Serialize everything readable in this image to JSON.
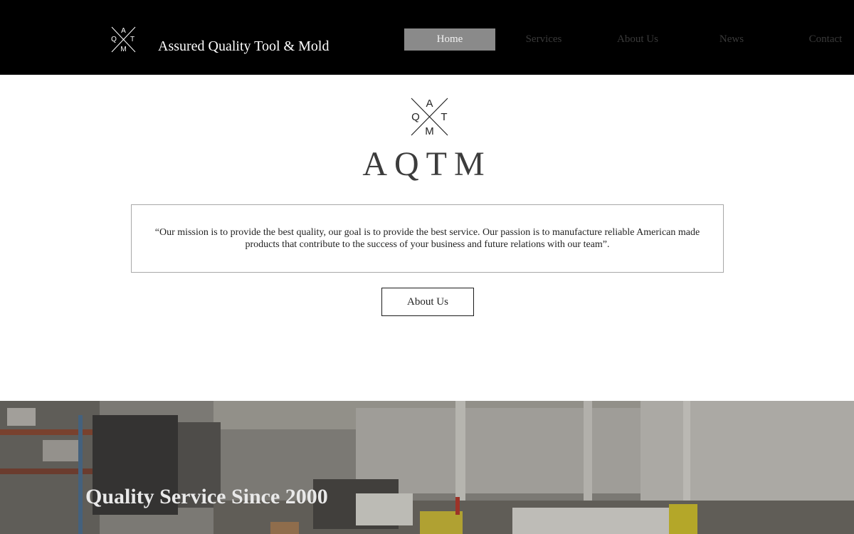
{
  "header": {
    "logo_letters": {
      "top": "A",
      "left": "Q",
      "right": "T",
      "bottom": "M"
    },
    "site_title": "Assured Quality Tool & Mold"
  },
  "nav": {
    "items": [
      {
        "label": "Home",
        "active": true
      },
      {
        "label": "Services",
        "active": false
      },
      {
        "label": "About Us",
        "active": false
      },
      {
        "label": "News",
        "active": false
      },
      {
        "label": "Contact",
        "active": false
      }
    ]
  },
  "hero": {
    "logo_letters": {
      "top": "A",
      "left": "Q",
      "right": "T",
      "bottom": "M"
    },
    "brand": "AQTM",
    "mission_line1": "“Our mission is to provide the best quality, our goal is to provide the best service. Our passion is to manufacture reliable American made",
    "mission_line2": "products that contribute to the success of your business and future relations with our team”.",
    "about_button": "About Us"
  },
  "banner": {
    "title": "Quality Service Since 2000"
  },
  "colors": {
    "header_bg": "#000000",
    "nav_active_bg": "#8a8a8a",
    "nav_text": "#3a3a3a",
    "brand_text": "#3c3c3c"
  }
}
